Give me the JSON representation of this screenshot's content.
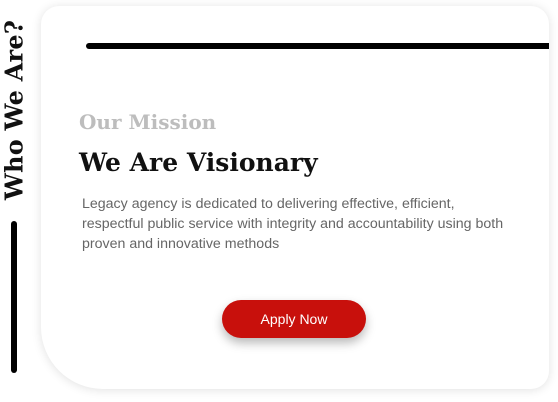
{
  "sidebar": {
    "title": "Who We Are?"
  },
  "mission": {
    "eyebrow": "Our Mission",
    "headline": "We Are Visionary",
    "body": "Legacy agency is dedicated to delivering effective, efficient, respectful public service with integrity and accountability using both proven and innovative methods",
    "cta_label": "Apply Now"
  },
  "colors": {
    "accent": "#c8100c",
    "eyebrow": "#bdbdbd",
    "heading": "#111111",
    "body": "#666666",
    "rule": "#000000"
  }
}
